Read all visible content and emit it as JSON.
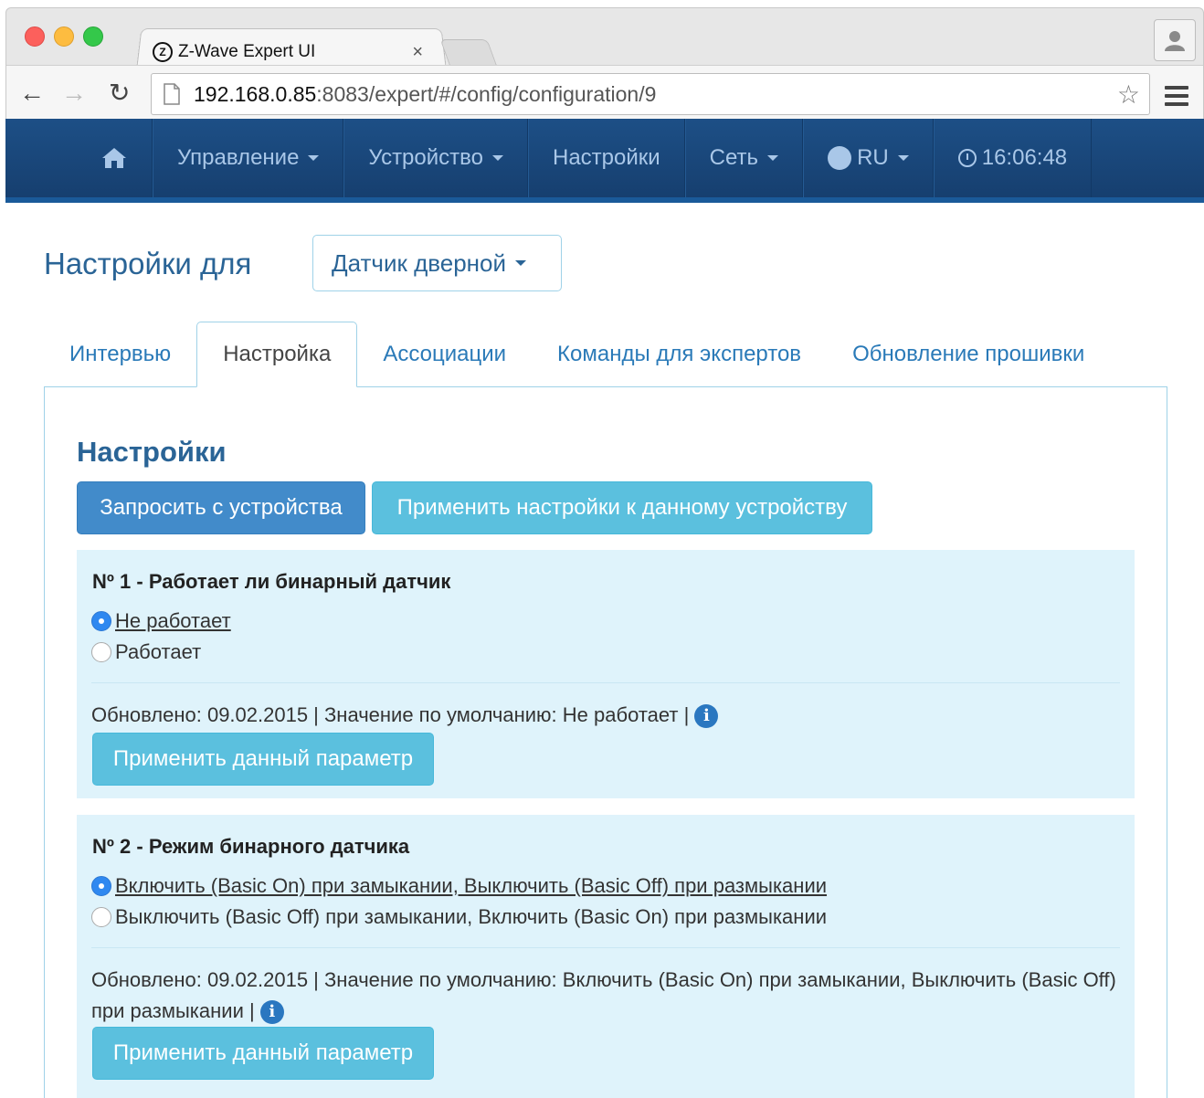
{
  "browser": {
    "tab_title": "Z-Wave Expert UI",
    "tab_favicon": "Z",
    "tab_close": "×",
    "url_host": "192.168.0.85",
    "url_rest": ":8083/expert/#/config/configuration/9"
  },
  "navbar": {
    "items": [
      {
        "label": "Управление",
        "dropdown": true
      },
      {
        "label": "Устройство",
        "dropdown": true
      },
      {
        "label": "Настройки",
        "dropdown": false
      },
      {
        "label": "Сеть",
        "dropdown": true
      },
      {
        "label": "RU",
        "dropdown": true
      },
      {
        "label": "16:06:48",
        "dropdown": false
      }
    ]
  },
  "header": {
    "title": "Настройки для",
    "device_selector": "Датчик дверной"
  },
  "tabs": [
    {
      "label": "Интервью",
      "active": false
    },
    {
      "label": "Настройка",
      "active": true
    },
    {
      "label": "Ассоциации",
      "active": false
    },
    {
      "label": "Команды для экспертов",
      "active": false
    },
    {
      "label": "Обновление прошивки",
      "active": false
    }
  ],
  "settings": {
    "title": "Настройки",
    "request_button": "Запросить с устройства",
    "apply_all_button": "Применить настройки к данному устройству",
    "apply_param_label": "Применить данный параметр",
    "params": [
      {
        "title": "Nº 1 - Работает ли бинарный датчик",
        "options": [
          "Не работает",
          "Работает"
        ],
        "selected": 0,
        "meta": "Обновлено: 09.02.2015 | Значение по умолчанию: Не работает |"
      },
      {
        "title": "Nº 2 - Режим бинарного датчика",
        "options": [
          "Включить (Basic On) при замыкании, Выключить (Basic Off) при размыкании",
          "Выключить (Basic Off) при замыкании, Включить (Basic On) при размыкании"
        ],
        "selected": 0,
        "meta": "Обновлено: 09.02.2015 | Значение по умолчанию: Включить (Basic On) при замыкании, Выключить (Basic Off) при размыкании |"
      }
    ]
  },
  "colors": {
    "navbar": "#1d4f86",
    "link": "#2a7ab8",
    "primary": "#428bca",
    "info": "#5bc0de",
    "panel_bg": "#dff3fb"
  }
}
